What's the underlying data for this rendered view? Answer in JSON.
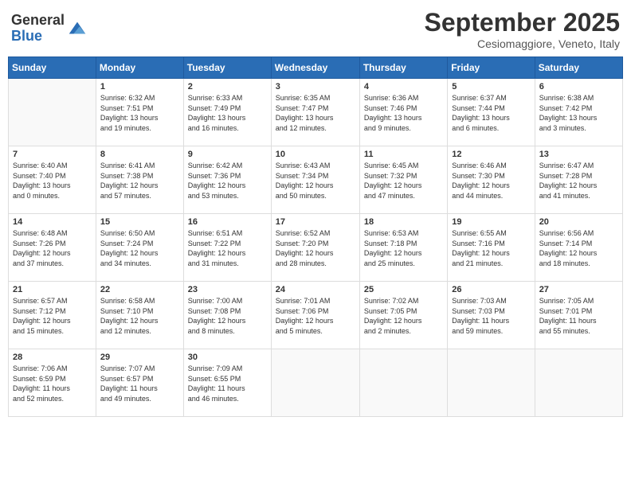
{
  "logo": {
    "general": "General",
    "blue": "Blue"
  },
  "title": "September 2025",
  "location": "Cesiomaggiore, Veneto, Italy",
  "weekdays": [
    "Sunday",
    "Monday",
    "Tuesday",
    "Wednesday",
    "Thursday",
    "Friday",
    "Saturday"
  ],
  "weeks": [
    [
      {
        "day": "",
        "info": ""
      },
      {
        "day": "1",
        "info": "Sunrise: 6:32 AM\nSunset: 7:51 PM\nDaylight: 13 hours\nand 19 minutes."
      },
      {
        "day": "2",
        "info": "Sunrise: 6:33 AM\nSunset: 7:49 PM\nDaylight: 13 hours\nand 16 minutes."
      },
      {
        "day": "3",
        "info": "Sunrise: 6:35 AM\nSunset: 7:47 PM\nDaylight: 13 hours\nand 12 minutes."
      },
      {
        "day": "4",
        "info": "Sunrise: 6:36 AM\nSunset: 7:46 PM\nDaylight: 13 hours\nand 9 minutes."
      },
      {
        "day": "5",
        "info": "Sunrise: 6:37 AM\nSunset: 7:44 PM\nDaylight: 13 hours\nand 6 minutes."
      },
      {
        "day": "6",
        "info": "Sunrise: 6:38 AM\nSunset: 7:42 PM\nDaylight: 13 hours\nand 3 minutes."
      }
    ],
    [
      {
        "day": "7",
        "info": "Sunrise: 6:40 AM\nSunset: 7:40 PM\nDaylight: 13 hours\nand 0 minutes."
      },
      {
        "day": "8",
        "info": "Sunrise: 6:41 AM\nSunset: 7:38 PM\nDaylight: 12 hours\nand 57 minutes."
      },
      {
        "day": "9",
        "info": "Sunrise: 6:42 AM\nSunset: 7:36 PM\nDaylight: 12 hours\nand 53 minutes."
      },
      {
        "day": "10",
        "info": "Sunrise: 6:43 AM\nSunset: 7:34 PM\nDaylight: 12 hours\nand 50 minutes."
      },
      {
        "day": "11",
        "info": "Sunrise: 6:45 AM\nSunset: 7:32 PM\nDaylight: 12 hours\nand 47 minutes."
      },
      {
        "day": "12",
        "info": "Sunrise: 6:46 AM\nSunset: 7:30 PM\nDaylight: 12 hours\nand 44 minutes."
      },
      {
        "day": "13",
        "info": "Sunrise: 6:47 AM\nSunset: 7:28 PM\nDaylight: 12 hours\nand 41 minutes."
      }
    ],
    [
      {
        "day": "14",
        "info": "Sunrise: 6:48 AM\nSunset: 7:26 PM\nDaylight: 12 hours\nand 37 minutes."
      },
      {
        "day": "15",
        "info": "Sunrise: 6:50 AM\nSunset: 7:24 PM\nDaylight: 12 hours\nand 34 minutes."
      },
      {
        "day": "16",
        "info": "Sunrise: 6:51 AM\nSunset: 7:22 PM\nDaylight: 12 hours\nand 31 minutes."
      },
      {
        "day": "17",
        "info": "Sunrise: 6:52 AM\nSunset: 7:20 PM\nDaylight: 12 hours\nand 28 minutes."
      },
      {
        "day": "18",
        "info": "Sunrise: 6:53 AM\nSunset: 7:18 PM\nDaylight: 12 hours\nand 25 minutes."
      },
      {
        "day": "19",
        "info": "Sunrise: 6:55 AM\nSunset: 7:16 PM\nDaylight: 12 hours\nand 21 minutes."
      },
      {
        "day": "20",
        "info": "Sunrise: 6:56 AM\nSunset: 7:14 PM\nDaylight: 12 hours\nand 18 minutes."
      }
    ],
    [
      {
        "day": "21",
        "info": "Sunrise: 6:57 AM\nSunset: 7:12 PM\nDaylight: 12 hours\nand 15 minutes."
      },
      {
        "day": "22",
        "info": "Sunrise: 6:58 AM\nSunset: 7:10 PM\nDaylight: 12 hours\nand 12 minutes."
      },
      {
        "day": "23",
        "info": "Sunrise: 7:00 AM\nSunset: 7:08 PM\nDaylight: 12 hours\nand 8 minutes."
      },
      {
        "day": "24",
        "info": "Sunrise: 7:01 AM\nSunset: 7:06 PM\nDaylight: 12 hours\nand 5 minutes."
      },
      {
        "day": "25",
        "info": "Sunrise: 7:02 AM\nSunset: 7:05 PM\nDaylight: 12 hours\nand 2 minutes."
      },
      {
        "day": "26",
        "info": "Sunrise: 7:03 AM\nSunset: 7:03 PM\nDaylight: 11 hours\nand 59 minutes."
      },
      {
        "day": "27",
        "info": "Sunrise: 7:05 AM\nSunset: 7:01 PM\nDaylight: 11 hours\nand 55 minutes."
      }
    ],
    [
      {
        "day": "28",
        "info": "Sunrise: 7:06 AM\nSunset: 6:59 PM\nDaylight: 11 hours\nand 52 minutes."
      },
      {
        "day": "29",
        "info": "Sunrise: 7:07 AM\nSunset: 6:57 PM\nDaylight: 11 hours\nand 49 minutes."
      },
      {
        "day": "30",
        "info": "Sunrise: 7:09 AM\nSunset: 6:55 PM\nDaylight: 11 hours\nand 46 minutes."
      },
      {
        "day": "",
        "info": ""
      },
      {
        "day": "",
        "info": ""
      },
      {
        "day": "",
        "info": ""
      },
      {
        "day": "",
        "info": ""
      }
    ]
  ]
}
